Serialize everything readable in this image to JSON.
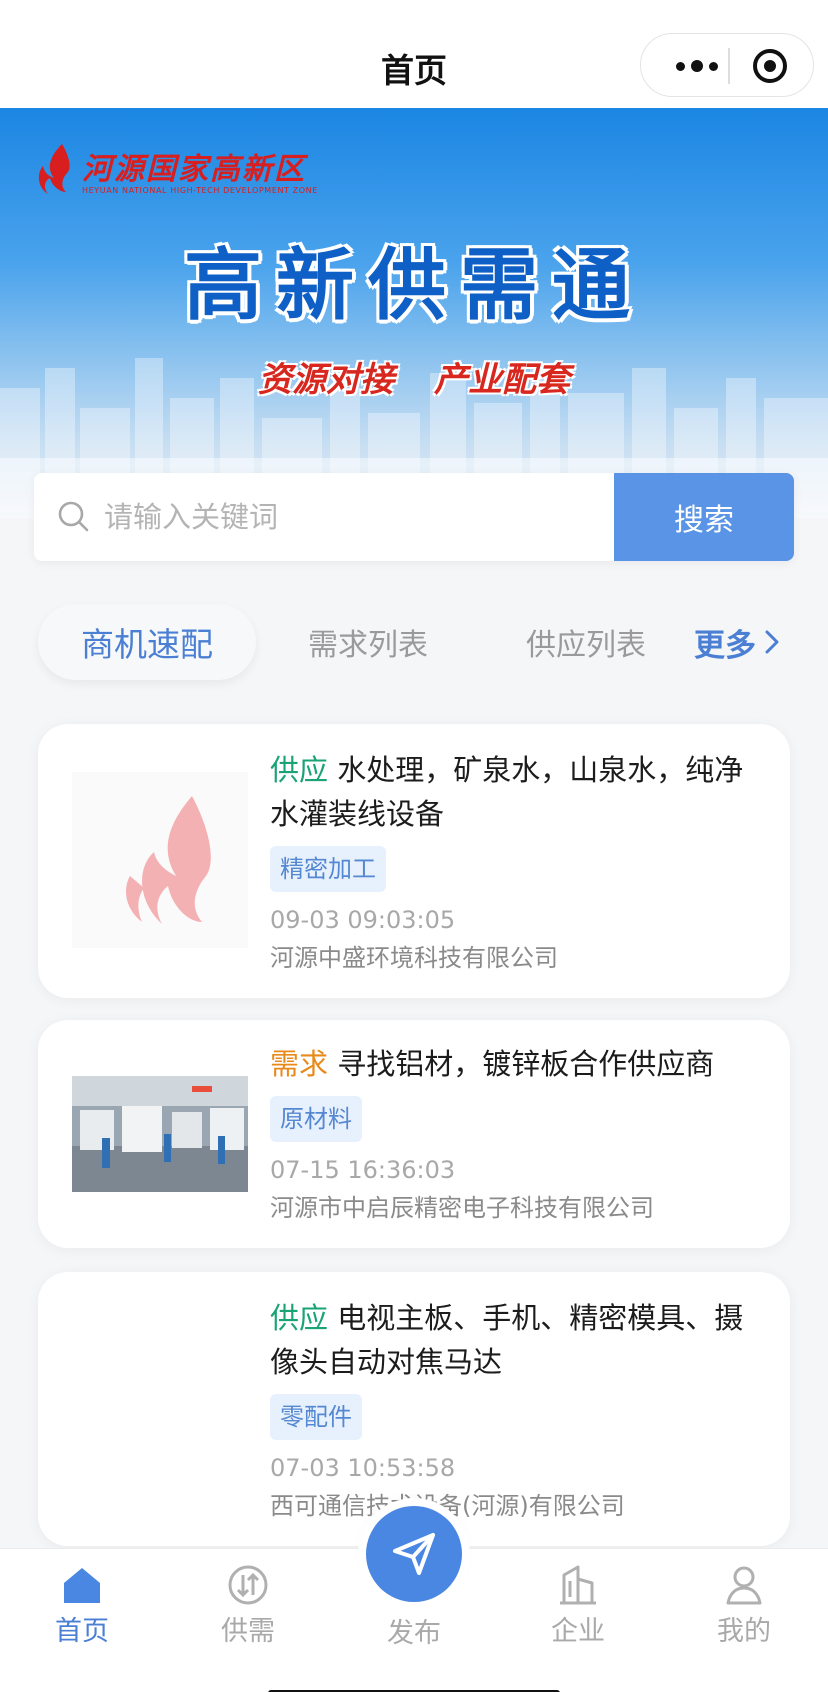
{
  "navbar": {
    "title": "首页"
  },
  "banner": {
    "logo_cn": "河源国家高新区",
    "logo_en": "HEYUAN NATIONAL HIGH-TECH DEVELOPMENT ZONE",
    "title": "高新供需通",
    "subtitle_left": "资源对接",
    "subtitle_right": "产业配套"
  },
  "search": {
    "placeholder": "请输入关键词",
    "button": "搜索"
  },
  "tabs": {
    "items": [
      "商机速配",
      "需求列表",
      "供应列表"
    ],
    "active_index": 0,
    "more": "更多"
  },
  "cards": [
    {
      "kind": "供应",
      "title": "水处理，矿泉水，山泉水，纯净水灌装线设备",
      "tag": "精密加工",
      "time": "09-03 09:03:05",
      "company": "河源中盛环境科技有限公司"
    },
    {
      "kind": "需求",
      "title": "寻找铝材，镀锌板合作供应商",
      "tag": "原材料",
      "time": "07-15 16:36:03",
      "company": "河源市中启辰精密电子科技有限公司"
    },
    {
      "kind": "供应",
      "title": "电视主板、手机、精密模具、摄像头自动对焦马达",
      "tag": "零配件",
      "time": "07-03 10:53:58",
      "company": "西可通信技术设备(河源)有限公司"
    }
  ],
  "tabbar": {
    "home": "首页",
    "supply_demand": "供需",
    "publish": "发布",
    "enterprise": "企业",
    "mine": "我的"
  },
  "colors": {
    "accent": "#4a7fd4",
    "supply": "#1aa374",
    "demand": "#e88a1a",
    "logo_red": "#d81e1e"
  },
  "icons": [
    "more-dots-icon",
    "close-target-icon",
    "search-icon",
    "chevron-right-icon",
    "home-icon",
    "supply-demand-icon",
    "paper-plane-icon",
    "building-icon",
    "user-icon"
  ]
}
